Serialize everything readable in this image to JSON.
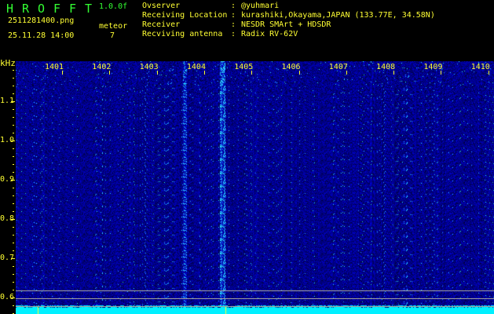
{
  "header": {
    "title_letters": [
      "H",
      "R",
      "O",
      "F",
      "F",
      "T"
    ],
    "version": "1.0.0f",
    "filename": "2511281400.png",
    "datetime": "25.11.28 14:00",
    "meteor_label": "meteor",
    "meteor_count": "7"
  },
  "info": {
    "labels": [
      "Ovserver",
      "Receiving Location",
      "Receiver",
      "Recviving antenna"
    ],
    "values": [
      "@yuhmari",
      "kurashiki,Okayama,JAPAN (133.77E, 34.58N)",
      "NESDR SMArt + HDSDR",
      "Radix RV-62V"
    ]
  },
  "axis": {
    "unit": "kHz",
    "freqs": [
      "1401",
      "1402",
      "1403",
      "1404",
      "1405",
      "1406",
      "1407",
      "1408",
      "1409",
      "1410"
    ],
    "yticks": [
      "1.1",
      "1.0",
      "0.9",
      "0.8",
      "0.7",
      "0.6"
    ]
  },
  "colors": {
    "bg": "#000000",
    "noise": "#1a2ad0",
    "spectrum": "#00f0ff",
    "label": "#ffff33"
  }
}
